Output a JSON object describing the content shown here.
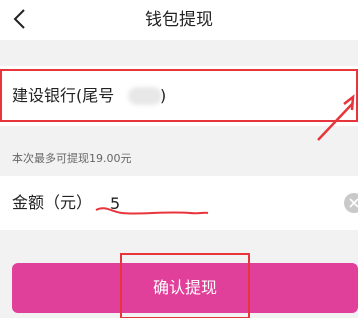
{
  "header": {
    "title": "钱包提现",
    "back_icon": "back-chevron-icon"
  },
  "bank": {
    "label": "建设银行(尾号",
    "close_paren": ")"
  },
  "hint": "本次最多可提现19.00元",
  "amount": {
    "label": "金额（元）",
    "value": "5",
    "clear_icon": "clear-icon"
  },
  "confirm_button": {
    "label": "确认提现"
  },
  "colors": {
    "accent": "#e03f9a",
    "annotation": "#e8343b",
    "background": "#f2f2f2"
  }
}
